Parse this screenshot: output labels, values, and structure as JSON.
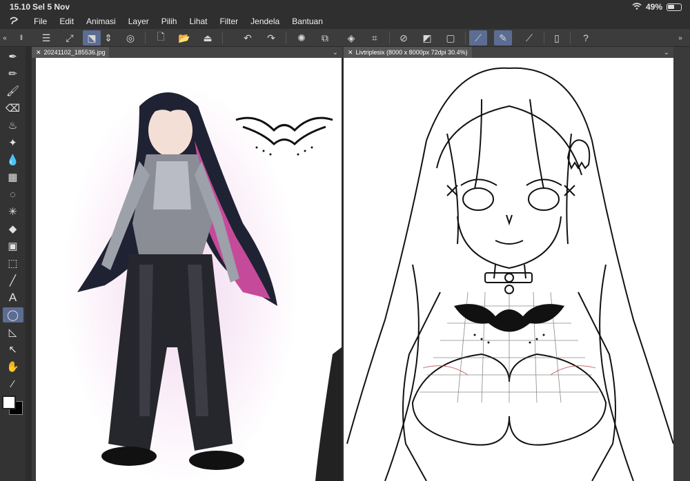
{
  "status": {
    "time": "15.10",
    "date": "Sel 5 Nov",
    "battery": "49%"
  },
  "menu": {
    "items": [
      "File",
      "Edit",
      "Animasi",
      "Layer",
      "Pilih",
      "Lihat",
      "Filter",
      "Jendela",
      "Bantuan"
    ]
  },
  "tabs": {
    "left": "20241102_185536.jpg",
    "right": "Livtriplesix (8000 x 8000px 72dpi 30.4%)"
  },
  "colors": {
    "accent": "#5b6d92",
    "main_color": "#ffffff",
    "sub_color": "#000000"
  }
}
